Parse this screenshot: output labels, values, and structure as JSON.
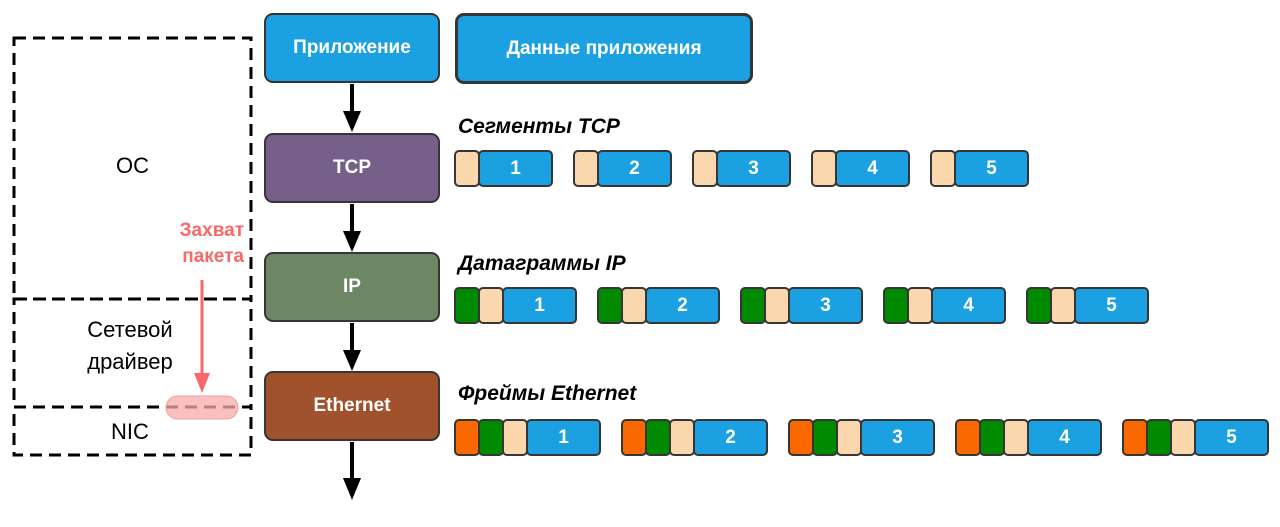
{
  "layers": [
    {
      "id": "app",
      "label": "Приложение",
      "color": "#1ba1e2"
    },
    {
      "id": "tcp",
      "label": "TCP",
      "color": "#76608a"
    },
    {
      "id": "ip",
      "label": "IP",
      "color": "#6d8764"
    },
    {
      "id": "ethernet",
      "label": "Ethernet",
      "color": "#a0522d"
    }
  ],
  "app_data": {
    "label": "Данные приложения"
  },
  "rows": [
    {
      "title": "Сегменты TCP",
      "headers": [
        "tcp"
      ],
      "packets": [
        "1",
        "2",
        "3",
        "4",
        "5"
      ]
    },
    {
      "title": "Датаграммы IP",
      "headers": [
        "ip",
        "tcp"
      ],
      "packets": [
        "1",
        "2",
        "3",
        "4",
        "5"
      ]
    },
    {
      "title": "Фреймы Ethernet",
      "headers": [
        "eth",
        "ip",
        "tcp"
      ],
      "packets": [
        "1",
        "2",
        "3",
        "4",
        "5"
      ]
    }
  ],
  "zones": {
    "os": "ОС",
    "driver_line1": "Сетевой",
    "driver_line2": "драйвер",
    "nic": "NIC"
  },
  "capture": {
    "line1": "Захват",
    "line2": "пакета",
    "color": "#f76868"
  },
  "header_colors": {
    "eth": "#fa6800",
    "ip": "#008a00",
    "tcp": "#fad7ac",
    "data": "#1ba1e2"
  }
}
